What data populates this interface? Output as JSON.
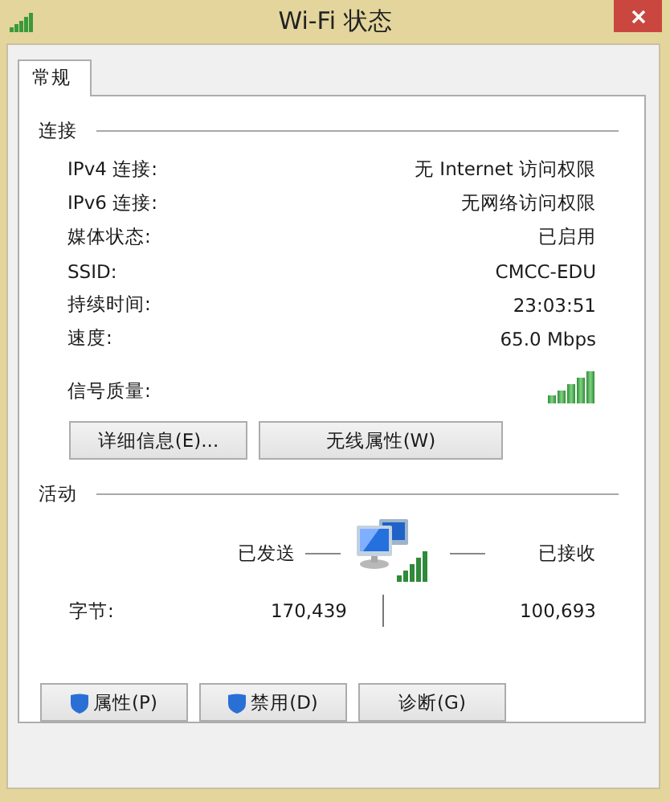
{
  "window": {
    "title": "Wi-Fi 状态"
  },
  "tabs": [
    {
      "label": "常规",
      "selected": true
    }
  ],
  "connection": {
    "heading": "连接",
    "rows": [
      {
        "label": "IPv4 连接:",
        "value": "无 Internet 访问权限"
      },
      {
        "label": "IPv6 连接:",
        "value": "无网络访问权限"
      },
      {
        "label": "媒体状态:",
        "value": "已启用"
      },
      {
        "label": "SSID:",
        "value": "CMCC-EDU"
      },
      {
        "label": "持续时间:",
        "value": "23:03:51"
      },
      {
        "label": "速度:",
        "value": "65.0 Mbps"
      }
    ],
    "signal_label": "信号质量:",
    "buttons": [
      "详细信息(E)...",
      "无线属性(W)"
    ]
  },
  "activity": {
    "heading": "活动",
    "sent_label": "已发送",
    "received_label": "已接收",
    "bytes_label": "字节:",
    "sent": "170,439",
    "received": "100,693"
  },
  "bottom_buttons": [
    {
      "label": "属性(P)",
      "shield": true
    },
    {
      "label": "禁用(D)",
      "shield": true
    },
    {
      "label": "诊断(G)",
      "shield": false
    }
  ]
}
